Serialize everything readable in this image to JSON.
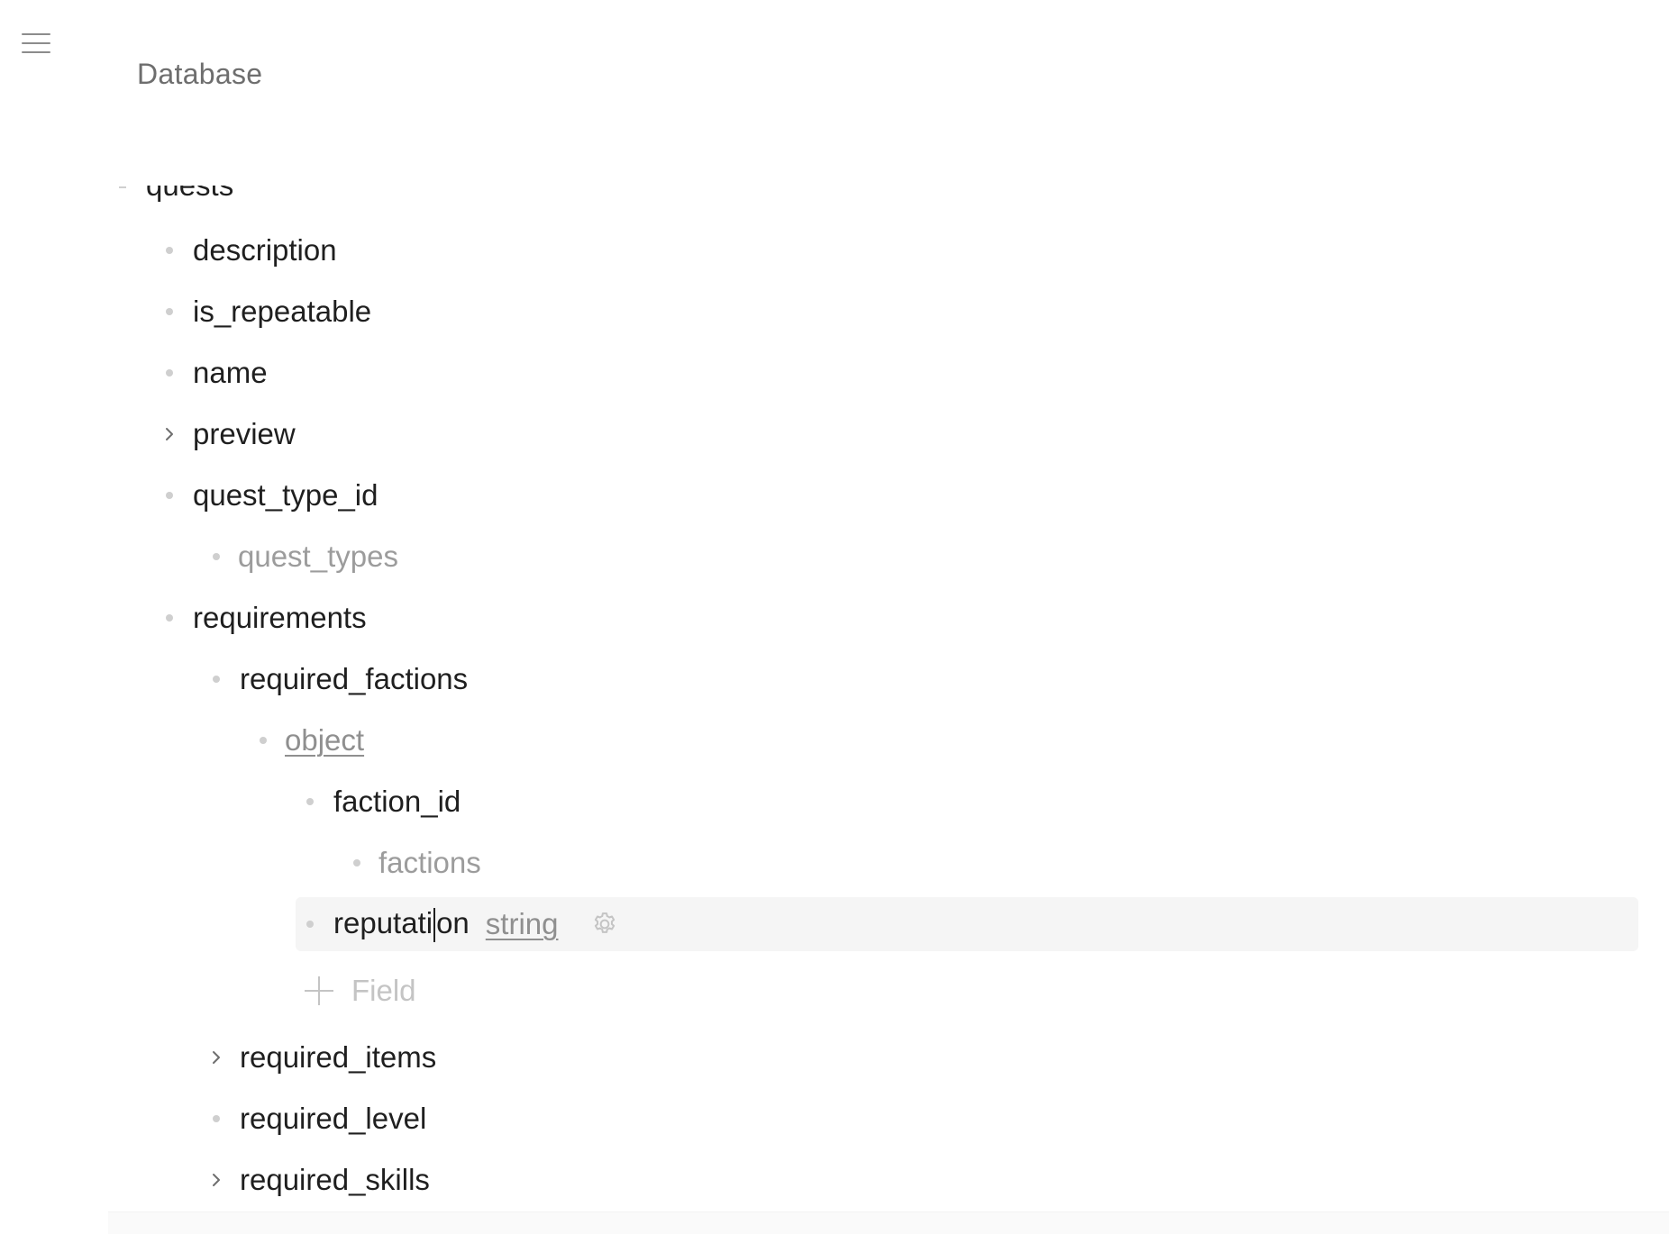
{
  "page": {
    "title": "Database"
  },
  "tree": {
    "root_label": "quests",
    "items": [
      {
        "label": "description"
      },
      {
        "label": "is_repeatable"
      },
      {
        "label": "name"
      },
      {
        "label": "preview"
      },
      {
        "label": "quest_type_id"
      },
      {
        "label": "quest_types"
      },
      {
        "label": "requirements"
      },
      {
        "label": "required_factions"
      },
      {
        "label": "object"
      },
      {
        "label": "faction_id"
      },
      {
        "label": "factions"
      },
      {
        "label_before_caret": "reputati",
        "label_after_caret": "on",
        "type": "string"
      },
      {
        "label": "required_items"
      },
      {
        "label": "required_level"
      },
      {
        "label": "required_skills"
      }
    ],
    "add_field_label": "Field"
  },
  "icons": {
    "menu": "hamburger-icon",
    "expand": "chevron-right-icon",
    "settings": "gear-icon",
    "add": "plus-icon"
  },
  "colors": {
    "selected_row_bg": "#f5f5f5",
    "muted_text": "#9c9c9c"
  }
}
